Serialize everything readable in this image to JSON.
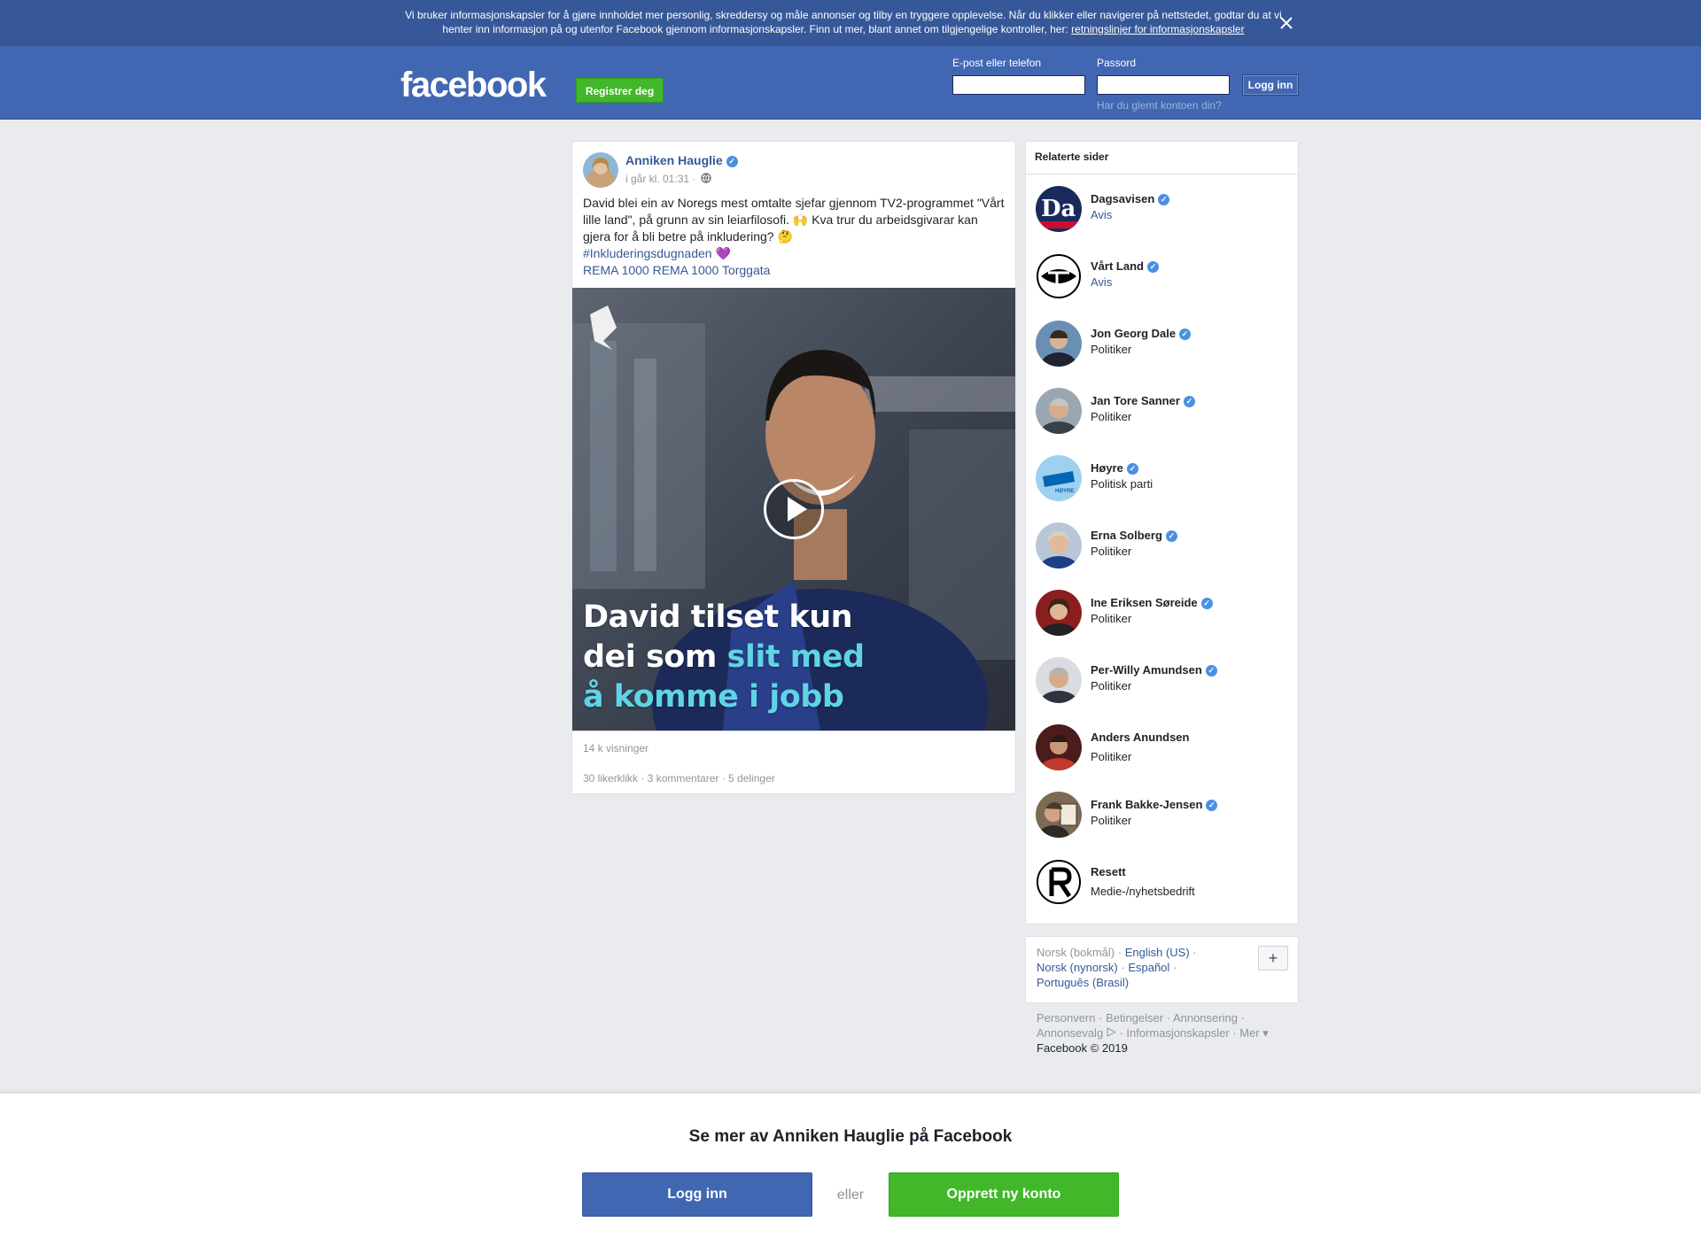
{
  "cookie_banner": {
    "text": "Vi bruker informasjonskapsler for å gjøre innholdet mer personlig, skreddersy og måle annonser og tilby en tryggere opplevelse. Når du klikker eller navigerer på nettstedet, godtar du at vi henter inn informasjon på og utenfor Facebook gjennom informasjonskapsler. Finn ut mer, blant annet om tilgjengelige kontroller, her:",
    "link": "retningslinjer for informasjonskapsler",
    "close_icon": "close-icon"
  },
  "header": {
    "logo": "facebook",
    "register_label": "Registrer deg",
    "email_label": "E-post eller telefon",
    "password_label": "Passord",
    "login_label": "Logg inn",
    "forgot_label": "Har du glemt kontoen din?"
  },
  "post": {
    "author": "Anniken Hauglie",
    "meta": "i går kl. 01:31 ·",
    "text": "David blei ein av Noregs mest omtalte sjefar gjennom TV2-programmet \"Vårt lille land\", på grunn av sin leiarfilosofi. 🙌 Kva trur du arbeidsgivarar kan gjera for å bli betre på inkludering? 🤔",
    "hashtag": "#Inkluderingsdugnaden 💜",
    "tags": "REMA 1000 REMA 1000 Torggata",
    "video_caption_1": "David tilset kun",
    "video_caption_2a": "dei som ",
    "video_caption_2b": "slit med",
    "video_caption_3": "å komme i jobb",
    "views": "14 k visninger",
    "engagement": "30 likerklikk · 3 kommentarer · 5 delinger"
  },
  "related": {
    "title": "Relaterte sider",
    "items": [
      {
        "name": "Dagsavisen",
        "sub": "Avis"
      },
      {
        "name": "Vårt Land",
        "sub": "Avis"
      },
      {
        "name": "Jon Georg Dale",
        "sub": "Politiker"
      },
      {
        "name": "Jan Tore Sanner",
        "sub": "Politiker"
      },
      {
        "name": "Høyre",
        "sub": "Politisk parti"
      },
      {
        "name": "Erna Solberg",
        "sub": "Politiker"
      },
      {
        "name": "Ine Eriksen Søreide",
        "sub": "Politiker"
      },
      {
        "name": "Per-Willy Amundsen",
        "sub": "Politiker"
      },
      {
        "name": "Anders Anundsen",
        "sub": "Politiker"
      },
      {
        "name": "Frank Bakke-Jensen",
        "sub": "Politiker"
      },
      {
        "name": "Resett",
        "sub": "Medie-/nyhetsbedrift"
      }
    ]
  },
  "languages": {
    "current": "Norsk (bokmål) ·",
    "english": "English (US)",
    "nynorsk": "Norsk (nynorsk)",
    "espanol": "Español",
    "portugues": "Português (Brasil)",
    "plus": "+"
  },
  "footer": {
    "privacy": "Personvern",
    "terms": "Betingelser",
    "ads": "Annonsering",
    "ad_choices": "Annonsevalg",
    "cookies": "Informasjonskapsler",
    "more": "Mer",
    "copyright": "Facebook © 2019"
  },
  "bottom": {
    "title": "Se mer av Anniken Hauglie på Facebook",
    "login": "Logg inn",
    "or": "eller",
    "create": "Opprett ny konto"
  },
  "colors": {
    "brand_blue": "#4267b2",
    "green": "#42b72a",
    "verified": "#4a90e2"
  }
}
